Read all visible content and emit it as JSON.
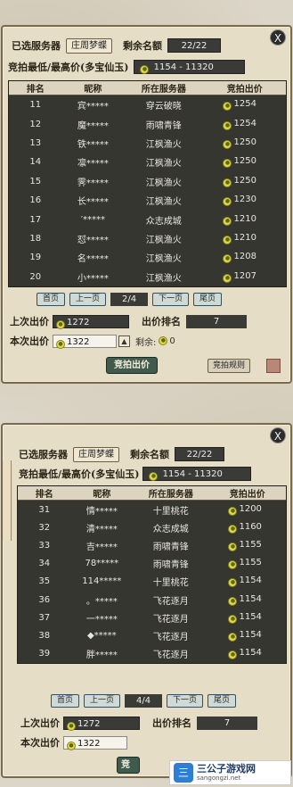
{
  "panels": [
    {
      "close_label": "X",
      "selected_server_label": "已选服务器",
      "selected_server_value": "庄周梦蝶",
      "remaining_quota_label": "剩余名额",
      "remaining_quota_value": "22/22",
      "price_range_label": "竞拍最低/最高价(多宝仙玉)",
      "price_range_value": "1154 - 11320",
      "columns": [
        "排名",
        "昵称",
        "所在服务器",
        "竞拍出价"
      ],
      "rows": [
        {
          "rank": "11",
          "name": "宾*****",
          "server": "穿云破晓",
          "bid": "1254"
        },
        {
          "rank": "12",
          "name": "魔*****",
          "server": "雨啸青锋",
          "bid": "1254"
        },
        {
          "rank": "13",
          "name": "铁*****",
          "server": "江枫渔火",
          "bid": "1250"
        },
        {
          "rank": "14",
          "name": "凛*****",
          "server": "江枫渔火",
          "bid": "1250"
        },
        {
          "rank": "15",
          "name": "霁*****",
          "server": "江枫渔火",
          "bid": "1250"
        },
        {
          "rank": "16",
          "name": "长*****",
          "server": "江枫渔火",
          "bid": "1230"
        },
        {
          "rank": "17",
          "name": "′*****",
          "server": "众志成城",
          "bid": "1210"
        },
        {
          "rank": "18",
          "name": "怼*****",
          "server": "江枫渔火",
          "bid": "1210"
        },
        {
          "rank": "19",
          "name": "名*****",
          "server": "江枫渔火",
          "bid": "1208"
        },
        {
          "rank": "20",
          "name": "小*****",
          "server": "江枫渔火",
          "bid": "1207"
        }
      ],
      "pager": {
        "first": "首页",
        "prev": "上一页",
        "page": "2/4",
        "next": "下一页",
        "last": "尾页"
      },
      "last_bid_label": "上次出价",
      "last_bid_value": "1272",
      "bid_rank_label": "出价排名",
      "bid_rank_value": "7",
      "current_bid_label": "本次出价",
      "current_bid_value": "1322",
      "remain_label": "剩余:",
      "remain_value": "0",
      "bid_button": "竞拍出价",
      "rules_button": "竞拍规则"
    },
    {
      "close_label": "X",
      "selected_server_label": "已选服务器",
      "selected_server_value": "庄周梦蝶",
      "remaining_quota_label": "剩余名额",
      "remaining_quota_value": "22/22",
      "price_range_label": "竞拍最低/最高价(多宝仙玉)",
      "price_range_value": "1154 - 11320",
      "columns": [
        "排名",
        "昵称",
        "所在服务器",
        "竞拍出价"
      ],
      "rows": [
        {
          "rank": "31",
          "name": "情*****",
          "server": "十里桃花",
          "bid": "1200"
        },
        {
          "rank": "32",
          "name": "清*****",
          "server": "众志成城",
          "bid": "1160"
        },
        {
          "rank": "33",
          "name": "吉*****",
          "server": "雨啸青锋",
          "bid": "1155"
        },
        {
          "rank": "34",
          "name": "78*****",
          "server": "雨啸青锋",
          "bid": "1155"
        },
        {
          "rank": "35",
          "name": "114*****",
          "server": "十里桃花",
          "bid": "1154"
        },
        {
          "rank": "36",
          "name": "。*****",
          "server": "飞花逐月",
          "bid": "1154"
        },
        {
          "rank": "37",
          "name": "一*****",
          "server": "飞花逐月",
          "bid": "1154"
        },
        {
          "rank": "38",
          "name": "◆*****",
          "server": "飞花逐月",
          "bid": "1154"
        },
        {
          "rank": "39",
          "name": "胖*****",
          "server": "飞花逐月",
          "bid": "1154"
        }
      ],
      "pager": {
        "first": "首页",
        "prev": "上一页",
        "page": "4/4",
        "next": "下一页",
        "last": "尾页"
      },
      "last_bid_label": "上次出价",
      "last_bid_value": "1272",
      "bid_rank_label": "出价排名",
      "bid_rank_value": "7",
      "current_bid_label": "本次出价",
      "current_bid_value": "1322",
      "bid_button": "竞"
    }
  ],
  "watermark": {
    "logo": "三",
    "name": "三公子游戏网",
    "url": "sangongzi.net"
  },
  "colors": {
    "panel_bg": "#e6ddc6",
    "table_bg": "#353630",
    "coin": "#e9d34a",
    "bid_button": "#405a4c"
  }
}
